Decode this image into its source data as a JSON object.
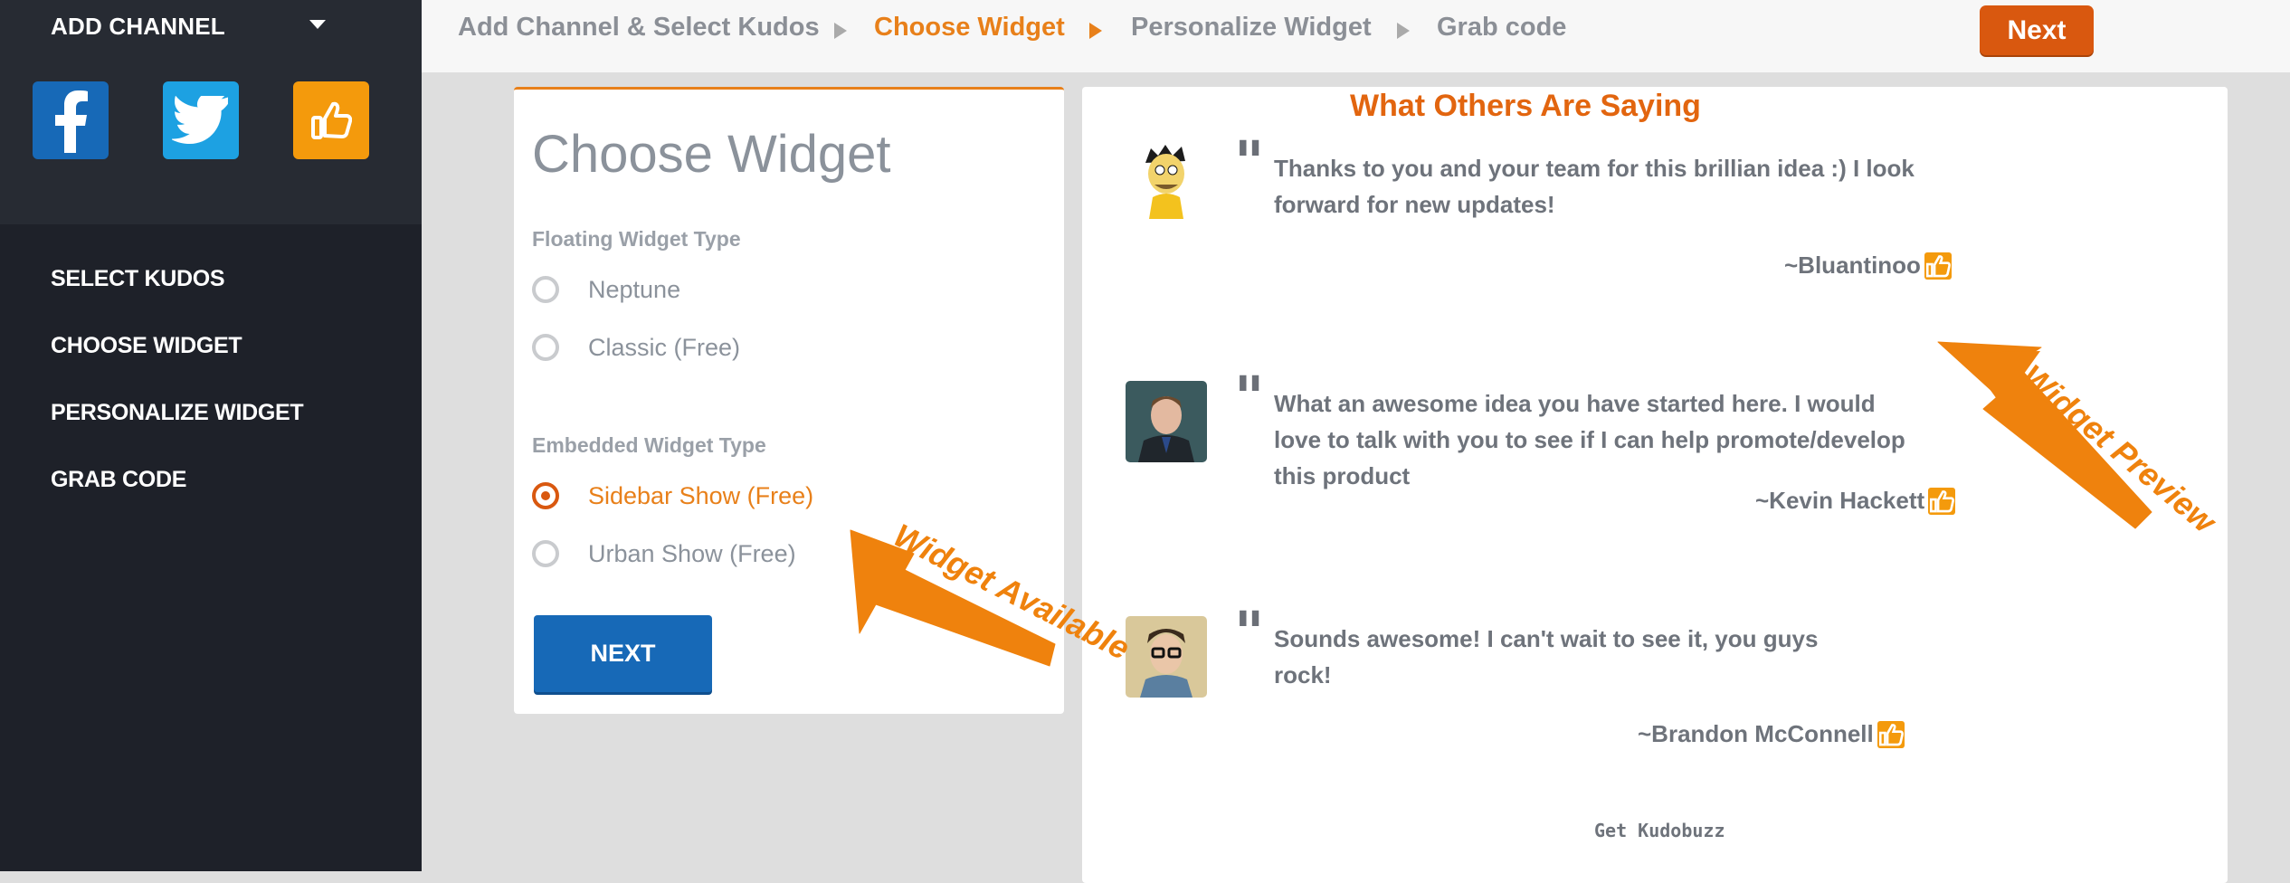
{
  "sidebar": {
    "add_channel": "ADD CHANNEL",
    "channels": [
      {
        "name": "facebook",
        "icon": "facebook-icon"
      },
      {
        "name": "twitter",
        "icon": "twitter-icon"
      },
      {
        "name": "kudos",
        "icon": "thumbs-up-icon"
      }
    ],
    "nav": [
      "SELECT KUDOS",
      "CHOOSE WIDGET",
      "PERSONALIZE WIDGET",
      "GRAB CODE"
    ]
  },
  "breadcrumb": {
    "steps": [
      "Add Channel & Select Kudos",
      "Choose Widget",
      "Personalize Widget",
      "Grab code"
    ],
    "active_index": 1
  },
  "top_next": "Next",
  "choose_panel": {
    "title": "Choose Widget",
    "floating_label": "Floating Widget Type",
    "floating_options": [
      {
        "label": "Neptune",
        "selected": false
      },
      {
        "label": "Classic (Free)",
        "selected": false
      }
    ],
    "embedded_label": "Embedded Widget Type",
    "embedded_options": [
      {
        "label": "Sidebar Show (Free)",
        "selected": true
      },
      {
        "label": "Urban Show (Free)",
        "selected": false
      }
    ],
    "next_button": "NEXT"
  },
  "preview": {
    "title": "What Others Are Saying",
    "testimonials": [
      {
        "text": "Thanks to you and your team for this brillian idea :) I look forward for new updates!",
        "author": "~Bluantinoo"
      },
      {
        "text": "What an awesome idea you have started here. I would love to talk with you to see if I can help promote/develop this product",
        "author": "~Kevin Hackett"
      },
      {
        "text": "Sounds awesome! I can't wait to see it, you guys rock!",
        "author": "~Brandon McConnell"
      }
    ],
    "footer": "Get Kudobuzz"
  },
  "annotations": {
    "widget_available": "Widget Available",
    "widget_preview": "Widget Preview"
  },
  "colors": {
    "sidebar_bg": "#1e2129",
    "accent_orange": "#e8801a",
    "next_orange": "#d9580f",
    "primary_blue": "#1769b7"
  }
}
